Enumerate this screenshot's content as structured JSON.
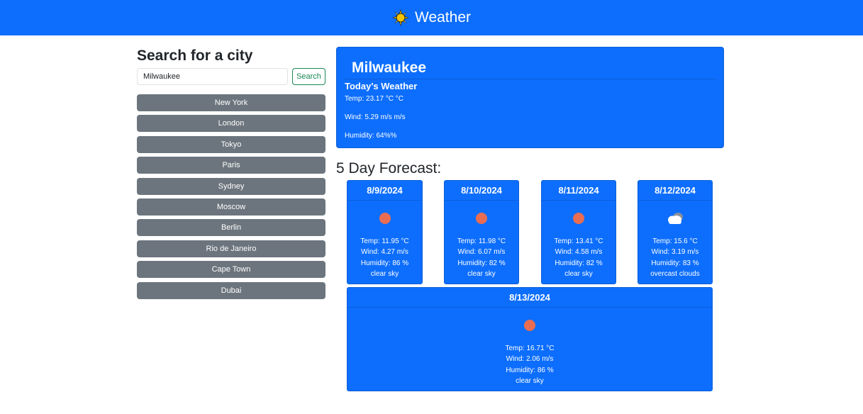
{
  "header": {
    "title": "Weather",
    "logo_icon": "sun-icon"
  },
  "sidebar": {
    "heading": "Search for a city",
    "search_value": "Milwaukee",
    "search_button": "Search",
    "cities": [
      "New York",
      "London",
      "Tokyo",
      "Paris",
      "Sydney",
      "Moscow",
      "Berlin",
      "Rio de Janeiro",
      "Cape Town",
      "Dubai"
    ]
  },
  "current": {
    "city": "Milwaukee",
    "subtitle": "Today's Weather",
    "temp": "Temp: 23.17 °C °C",
    "wind": "Wind: 5.29 m/s m/s",
    "humidity": "Humidity: 64%%"
  },
  "forecast": {
    "title": "5 Day Forecast:",
    "days": [
      {
        "date": "8/9/2024",
        "icon": "clear-sky-icon",
        "temp": "Temp: 11.95 °C",
        "wind": "Wind: 4.27 m/s",
        "humidity": "Humidity: 86 %",
        "desc": "clear sky"
      },
      {
        "date": "8/10/2024",
        "icon": "clear-sky-icon",
        "temp": "Temp: 11.98 °C",
        "wind": "Wind: 6.07 m/s",
        "humidity": "Humidity: 82 %",
        "desc": "clear sky"
      },
      {
        "date": "8/11/2024",
        "icon": "clear-sky-icon",
        "temp": "Temp: 13.41 °C",
        "wind": "Wind: 4.58 m/s",
        "humidity": "Humidity: 82 %",
        "desc": "clear sky"
      },
      {
        "date": "8/12/2024",
        "icon": "overcast-cloud-icon",
        "temp": "Temp: 15.6 °C",
        "wind": "Wind: 3.19 m/s",
        "humidity": "Humidity: 83 %",
        "desc": "overcast clouds"
      },
      {
        "date": "8/13/2024",
        "icon": "clear-sky-icon",
        "temp": "Temp: 16.71 °C",
        "wind": "Wind: 2.06 m/s",
        "humidity": "Humidity: 86 %",
        "desc": "clear sky"
      }
    ]
  },
  "colors": {
    "primary": "#0d6efd",
    "secondary": "#6c757d",
    "success": "#198754",
    "sun": "#e96d52"
  }
}
